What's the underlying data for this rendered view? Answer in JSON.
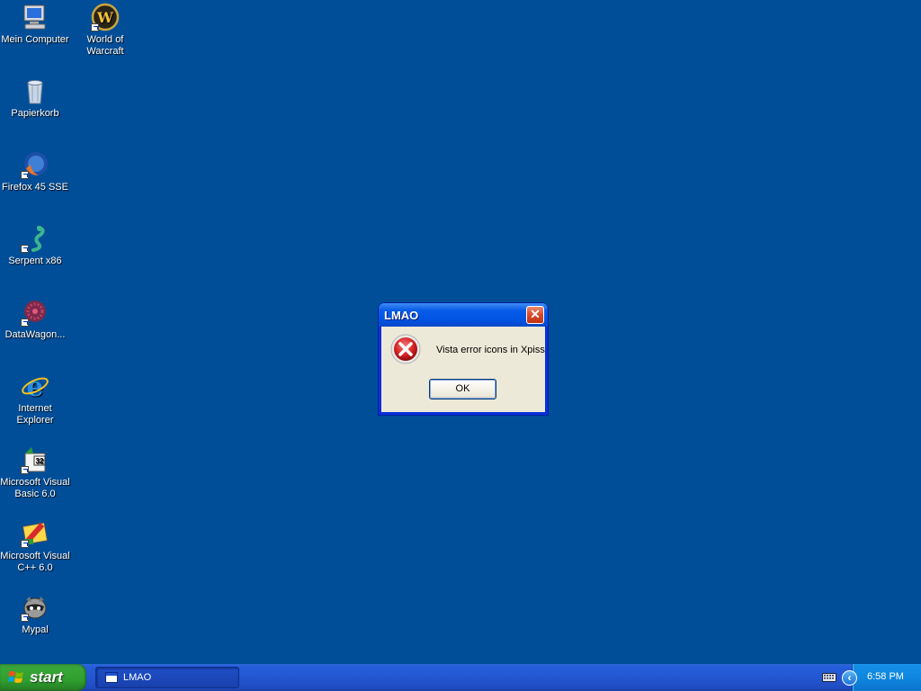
{
  "desktop": {
    "background": "#004e98",
    "icons": [
      {
        "label": "Mein Computer",
        "icon": "computer-icon",
        "shortcut": false
      },
      {
        "label": "World of Warcraft",
        "icon": "wow-icon",
        "shortcut": true
      },
      {
        "label": "Papierkorb",
        "icon": "recycle-bin-icon",
        "shortcut": false
      },
      {
        "label": "Firefox 45 SSE",
        "icon": "firefox-icon",
        "shortcut": true
      },
      {
        "label": "Serpent x86",
        "icon": "serpent-icon",
        "shortcut": true
      },
      {
        "label": "DataWagon...",
        "icon": "datawagon-icon",
        "shortcut": true
      },
      {
        "label": "Internet Explorer",
        "icon": "ie-icon",
        "shortcut": false
      },
      {
        "label": "Microsoft Visual Basic 6.0",
        "icon": "vb6-icon",
        "shortcut": true
      },
      {
        "label": "Microsoft Visual C++ 6.0",
        "icon": "vcpp-icon",
        "shortcut": true
      },
      {
        "label": "Mypal",
        "icon": "mypal-icon",
        "shortcut": true
      }
    ]
  },
  "dialog": {
    "title": "LMAO",
    "close_label": "✕",
    "icon": "error-icon",
    "message": "Vista error icons in Xpiss",
    "ok_label": "OK"
  },
  "taskbar": {
    "start_label": "start",
    "tasks": [
      {
        "label": "LMAO"
      }
    ],
    "tray": {
      "clock": "6:58 PM",
      "chevron": "‹"
    }
  }
}
